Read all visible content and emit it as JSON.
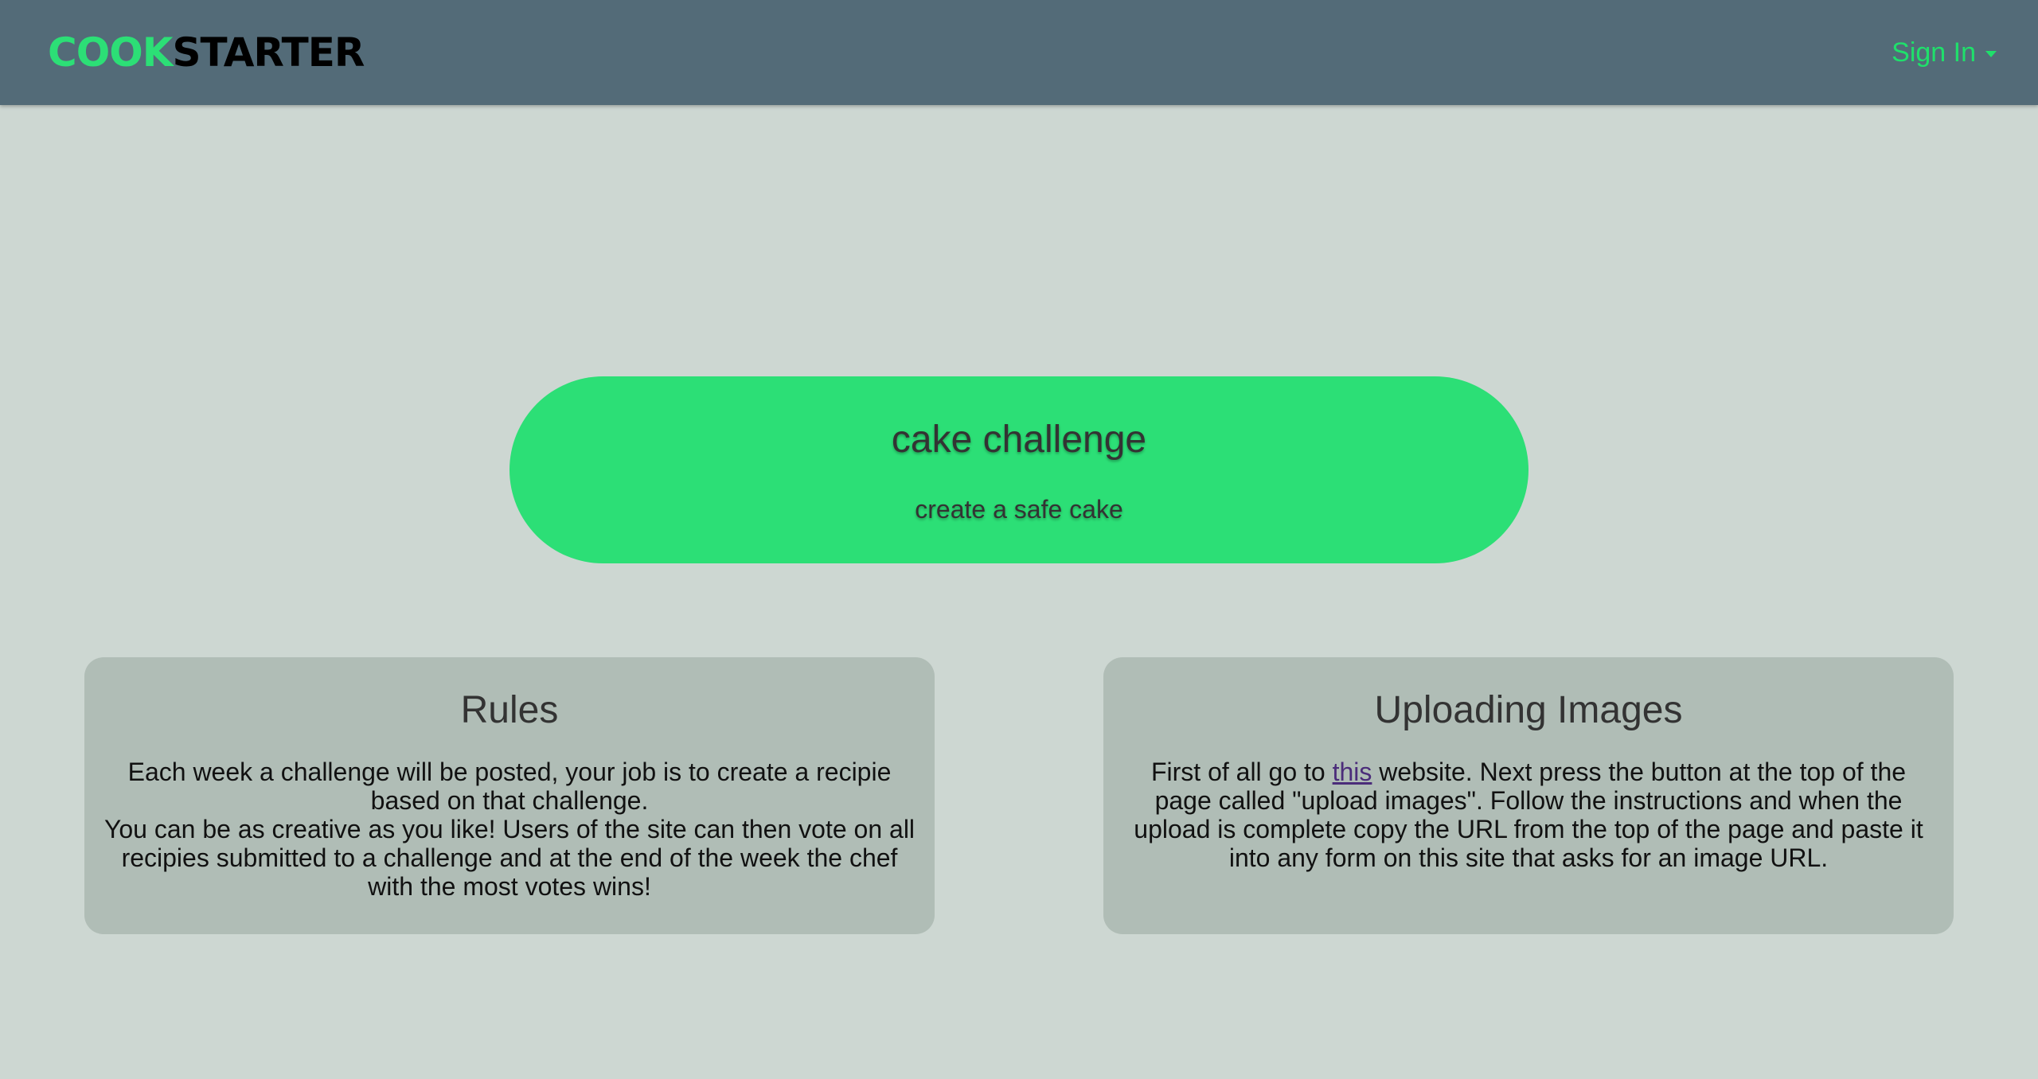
{
  "navbar": {
    "logo_part1": "COOK",
    "logo_part2": "STARTER",
    "signin_label": "Sign In"
  },
  "hero": {
    "title": "cake challenge",
    "subtitle": "create a safe cake"
  },
  "rules": {
    "title": "Rules",
    "paragraph1": "Each week a challenge will be posted, your job is to create a recipie based on that challenge.",
    "paragraph2": "You can be as creative as you like! Users of the site can then vote on all recipies submitted to a challenge and at the end of the week the chef with the most votes wins!"
  },
  "uploading": {
    "title": "Uploading Images",
    "text_before_link": "First of all go to ",
    "link_text": "this",
    "text_after_link": " website. Next press the button at the top of the page called \"upload images\". Follow the instructions and when the upload is complete copy the URL from the top of the page and paste it into any form on this site that asks for an image URL."
  },
  "colors": {
    "navbar_bg": "#536b78",
    "accent_green": "#2cdf76",
    "page_bg": "#cdd7d2",
    "card_bg": "#b0bdb6"
  },
  "icons": {
    "signin_dropdown": "caret-down-icon"
  }
}
